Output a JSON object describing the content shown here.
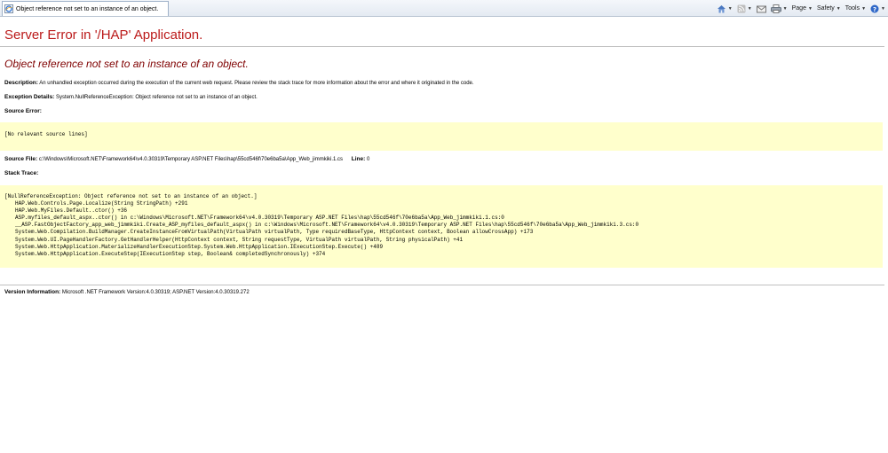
{
  "browser": {
    "tab_title": "Object reference not set to an instance of an object.",
    "commands": {
      "page_label": "Page",
      "safety_label": "Safety",
      "tools_label": "Tools"
    }
  },
  "error": {
    "title": "Server Error in '/HAP' Application.",
    "message": "Object reference not set to an instance of an object.",
    "description_label": "Description:",
    "description_text": "An unhandled exception occurred during the execution of the current web request. Please review the stack trace for more information about the error and where it originated in the code.",
    "exception_label": "Exception Details:",
    "exception_text": "System.NullReferenceException: Object reference not set to an instance of an object.",
    "source_error_label": "Source Error:",
    "source_error_text": "[No relevant source lines]",
    "source_file_label": "Source File:",
    "source_file_text": "c:\\Windows\\Microsoft.NET\\Framework64\\v4.0.30319\\Temporary ASP.NET Files\\hap\\55cd546f\\70e6ba5a\\App_Web_jimmkiki.1.cs",
    "line_label": "Line:",
    "line_value": "0",
    "stack_trace_label": "Stack Trace:",
    "stack_trace": [
      "[NullReferenceException: Object reference not set to an instance of an object.]",
      "HAP.Web.Controls.Page.Localize(String StringPath) +291",
      "HAP.Web.MyFiles.Default..ctor() +36",
      "ASP.myfiles_default_aspx..ctor() in c:\\Windows\\Microsoft.NET\\Framework64\\v4.0.30319\\Temporary ASP.NET Files\\hap\\55cd546f\\70e6ba5a\\App_Web_jimmkiki.1.cs:0",
      "__ASP.FastObjectFactory_app_web_jimmkiki.Create_ASP_myfiles_default_aspx() in c:\\Windows\\Microsoft.NET\\Framework64\\v4.0.30319\\Temporary ASP.NET Files\\hap\\55cd546f\\70e6ba5a\\App_Web_jimmkiki.3.cs:0",
      "System.Web.Compilation.BuildManager.CreateInstanceFromVirtualPath(VirtualPath virtualPath, Type requiredBaseType, HttpContext context, Boolean allowCrossApp) +173",
      "System.Web.UI.PageHandlerFactory.GetHandlerHelper(HttpContext context, String requestType, VirtualPath virtualPath, String physicalPath) +41",
      "System.Web.HttpApplication.MaterializeHandlerExecutionStep.System.Web.HttpApplication.IExecutionStep.Execute() +489",
      "System.Web.HttpApplication.ExecuteStep(IExecutionStep step, Boolean& completedSynchronously) +374"
    ],
    "version_label": "Version Information:",
    "version_text": "Microsoft .NET Framework Version:4.0.30319; ASP.NET Version:4.0.30319.272"
  },
  "colors": {
    "title_red": "#bb1a1a",
    "message_maroon": "#7f0000",
    "code_background": "#ffffcc"
  },
  "icons": [
    "ie-page-icon",
    "home-icon",
    "feeds-icon",
    "read-mail-icon",
    "print-icon",
    "help-icon"
  ]
}
